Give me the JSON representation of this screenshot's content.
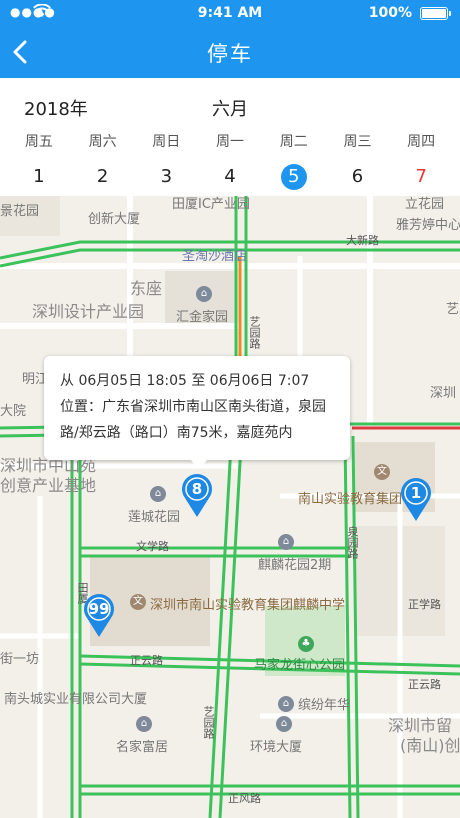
{
  "status_bar": {
    "time": "9:41 AM",
    "battery": "100%"
  },
  "header": {
    "title": "停车"
  },
  "calendar": {
    "year": "2018年",
    "month": "六月",
    "days": [
      {
        "name": "周五",
        "num": "1"
      },
      {
        "name": "周六",
        "num": "2"
      },
      {
        "name": "周日",
        "num": "3"
      },
      {
        "name": "周一",
        "num": "4"
      },
      {
        "name": "周二",
        "num": "5"
      },
      {
        "name": "周三",
        "num": "6"
      },
      {
        "name": "周四",
        "num": "7"
      }
    ],
    "selected_index": 4,
    "highlight_index": 6
  },
  "popup": {
    "from_label": "从",
    "from_time": "06月05日 18:05",
    "to_label": "至",
    "to_time": "06月06日 7:07",
    "location_label": "位置：",
    "location": "广东省深圳市南山区南头街道，泉园路/郑云路（路口）南75米，嘉庭苑内"
  },
  "pins": [
    {
      "label": "8"
    },
    {
      "label": "1"
    },
    {
      "label": "99"
    }
  ],
  "map_labels": {
    "jingkehuayuan": "景花园",
    "chuangxindasha": "创新大厦",
    "tianxia": "田厦IC产业园",
    "lifangyuan": "立花园",
    "yafangting": "雅芳婷中心",
    "shengtaosha": "圣淘沙酒店",
    "xinxinlu": "大新路",
    "dongzuo": "东座",
    "sheji": "深圳设计产业园",
    "huijin": "汇金家园",
    "yiyuanlu": "艺园路",
    "mingjiang": "明江",
    "dayuan": "大院",
    "shen_right": "深圳",
    "zhongshan": "深圳市中山苑",
    "chuangyi": "创意产业基地",
    "liancheng": "莲城花园",
    "nanshan_shiyan": "南山实验教育集团",
    "wenxuelu": "文学路",
    "qilinhuayuan": "麒麟花园2期",
    "quanyuanlu": "泉园路",
    "zhengxuelu": "正学路",
    "qilinzhongxue": "深圳市南山实验教育集团麒麟中学",
    "zhengyunlu_left": "正云路",
    "majialong": "马家龙街心公园",
    "nantoucheng": "南头城实业有限公司大厦",
    "binfen": "缤纷年华",
    "zhengyunlu_right": "正云路",
    "mingjiafu": "名家富居",
    "huanjing": "环境大厦",
    "yiyuanlu2": "艺园路",
    "shenzhen_liu": "深圳市留",
    "nanshan_c": "(南山)创",
    "zhengfenglu": "正风路",
    "tianxia_lu": "田厦",
    "xiajiefang": "街一坊",
    "yi": "艺"
  },
  "colors": {
    "header_blue": "#1e96f0",
    "traffic_green": "#3cc25a",
    "traffic_orange": "#f08a24",
    "traffic_red": "#e0383e",
    "pin_blue": "#1e88e5"
  }
}
